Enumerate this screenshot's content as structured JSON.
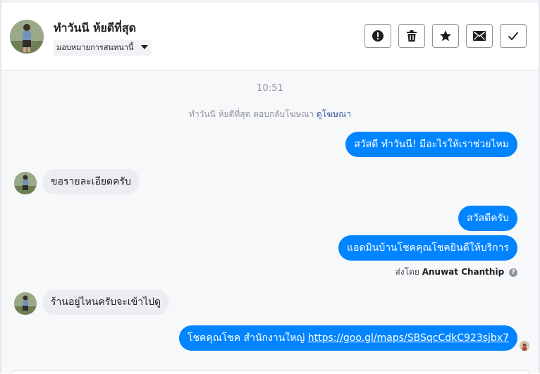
{
  "contact": {
    "name": "ทำวันนี ห้ยดีที่สุด",
    "assign_label": "มอบหมายการสนทนานี้"
  },
  "actions": [
    {
      "name": "spam-icon"
    },
    {
      "name": "trash-icon"
    },
    {
      "name": "star-icon"
    },
    {
      "name": "mail-icon"
    },
    {
      "name": "check-icon"
    }
  ],
  "thread": {
    "timestamp": "10:51",
    "ad_reply_prefix": "ทำวันนี ห้ยดีที่สุด ตอบกลับโฆษณา",
    "ad_reply_link": "ดูโฆษณา",
    "messages": [
      {
        "from": "page",
        "text": "สวัสดี ทำวันนี! มีอะไรให้เราช่วยไหม"
      },
      {
        "from": "user",
        "text": "ขอรายละเอียดครับ"
      },
      {
        "from": "page",
        "text": "สวัสดีครับ"
      },
      {
        "from": "page",
        "text": "แอดมินบ้านโชคคุณโชคยินดีให้บริการ"
      },
      {
        "from": "user",
        "text": "ร้านอยู่ไหนครับจะเข้าไปดู"
      },
      {
        "from": "page",
        "text": "โชคคุณโชค สำนักงานใหญ่ ",
        "link": "https://goo.gl/maps/SBSqcCdkC923sjbx7"
      }
    ],
    "sent_by_label": "ส่งโดย",
    "sent_by_name": "Anuwat Chanthip",
    "help_glyph": "?"
  },
  "colors": {
    "outgoing_bubble": "#0084ff",
    "incoming_bubble": "#ebedf0",
    "link": "#385898"
  }
}
